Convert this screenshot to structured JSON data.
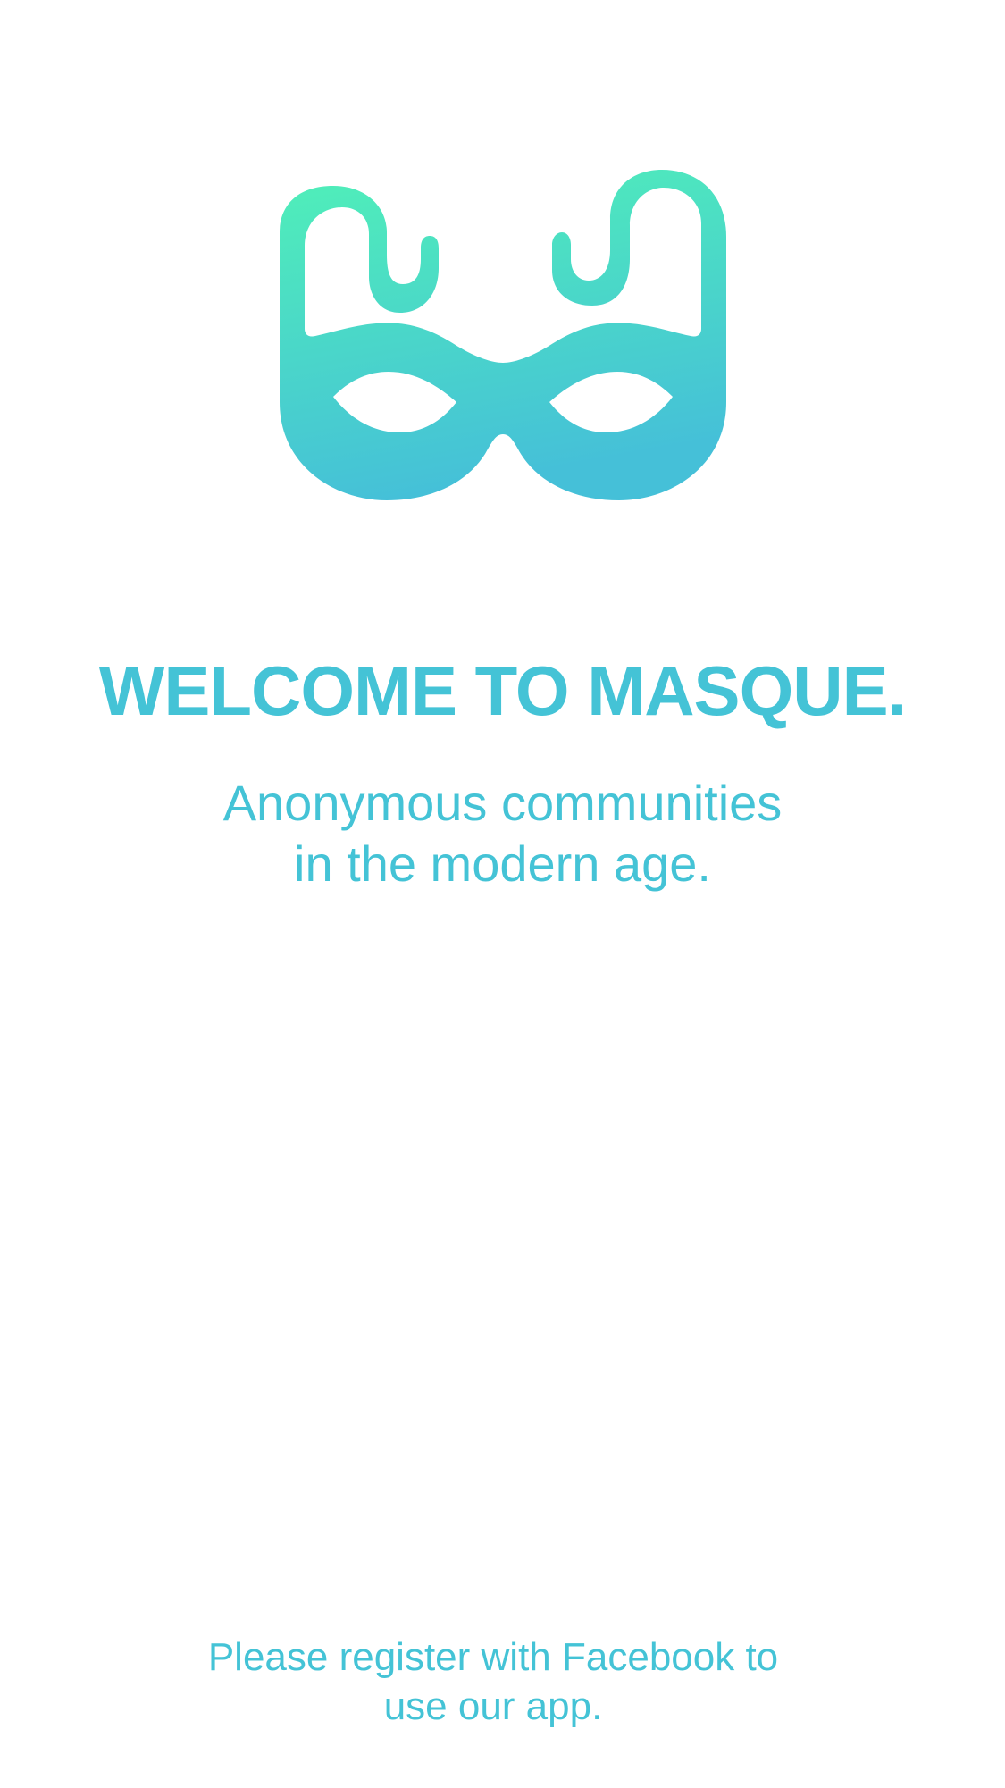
{
  "welcome": {
    "title": "WELCOME TO MASQUE.",
    "tagline_line1": "Anonymous communities",
    "tagline_line2": "in the modern age.",
    "register_line1": "Please register with Facebook to",
    "register_line2": "use our app."
  },
  "logo": {
    "icon": "masque-logo-icon",
    "gradient_top": "#50f0b8",
    "gradient_bottom": "#45c0d8"
  },
  "colors": {
    "accent": "#44c3d6",
    "background": "#ffffff"
  }
}
